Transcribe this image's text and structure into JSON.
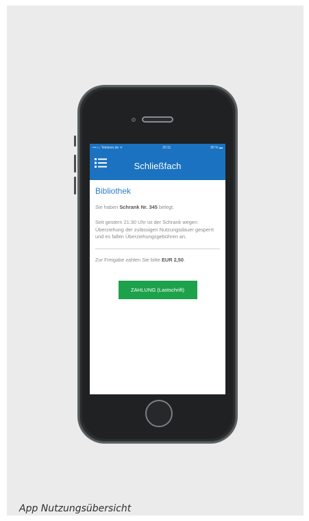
{
  "statusbar": {
    "carrier": "•••○○ Telekom.de ᯤ",
    "time": "20:11",
    "battery": "90 % ▬"
  },
  "navbar": {
    "title": "Schließfach",
    "menu_icon": "list-menu-icon"
  },
  "content": {
    "section_title": "Bibliothek",
    "p1_prefix": "Sie haben ",
    "p1_bold": "Schrank Nr. 345",
    "p1_suffix": " belegt.",
    "p2": "Seit gestern 21:30 Uhr ist der Schrank wegen Überziehung der zulässigen Nutzungsdauer gesperrt und es fallen Überziehungsgebühren an.",
    "p3_prefix": "Zur Freigabe zahlen Sie bitte ",
    "p3_bold": "EUR 2,50",
    "p3_suffix": ".",
    "pay_button": "ZAHLUNG (Lastschrift)"
  },
  "caption": "App Nutzungsübersicht",
  "colors": {
    "brand_blue": "#1b72c0",
    "title_blue": "#2b7ec4",
    "button_green": "#1da24b"
  }
}
